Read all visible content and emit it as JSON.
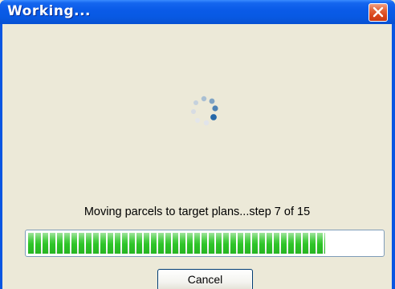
{
  "window": {
    "title": "Working..."
  },
  "status": {
    "message": "Moving parcels to target plans...step 7 of 15",
    "progress_step": 7,
    "progress_total": 15,
    "progress_fraction": 0.84
  },
  "buttons": {
    "cancel_label": "Cancel"
  },
  "icons": {
    "close": "close-icon",
    "spinner": "loading-spinner-icon"
  },
  "colors": {
    "titlebar": "#0A5BE8",
    "client_bg": "#ECE9D8",
    "progress_fill": "#2DC527",
    "close_button": "#D9441A"
  }
}
